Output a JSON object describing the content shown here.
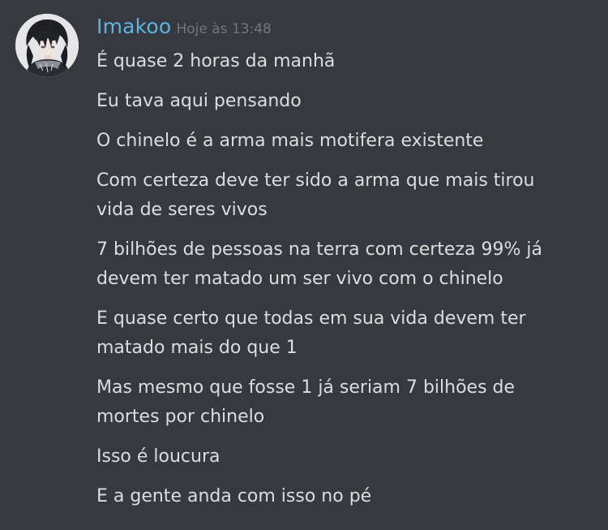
{
  "author": {
    "name": "Imakoo",
    "timestamp": "Hoje às 13:48",
    "avatar_icon": "anime-character-avatar"
  },
  "colors": {
    "background": "#36393f",
    "username": "#5db4e0",
    "timestamp": "#72767d",
    "message_text": "#dcddde"
  },
  "messages": [
    {
      "lines": [
        "É quase 2 horas da manhã"
      ]
    },
    {
      "lines": [
        "Eu tava aqui pensando"
      ]
    },
    {
      "lines": [
        "O chinelo é a arma mais motifera existente"
      ]
    },
    {
      "lines": [
        "Com certeza deve ter sido a arma que mais tirou",
        "vida de seres vivos"
      ]
    },
    {
      "lines": [
        "7 bilhões de pessoas na terra com certeza 99% já",
        "devem ter matado um ser vivo com o chinelo"
      ]
    },
    {
      "lines": [
        "E quase certo que todas em sua vida devem ter",
        "matado mais do que 1"
      ]
    },
    {
      "lines": [
        "Mas mesmo que fosse 1 já seriam 7 bilhões de",
        "mortes por chinelo"
      ]
    },
    {
      "lines": [
        "Isso é loucura"
      ]
    },
    {
      "lines": [
        "E a gente anda com isso no pé"
      ]
    }
  ]
}
